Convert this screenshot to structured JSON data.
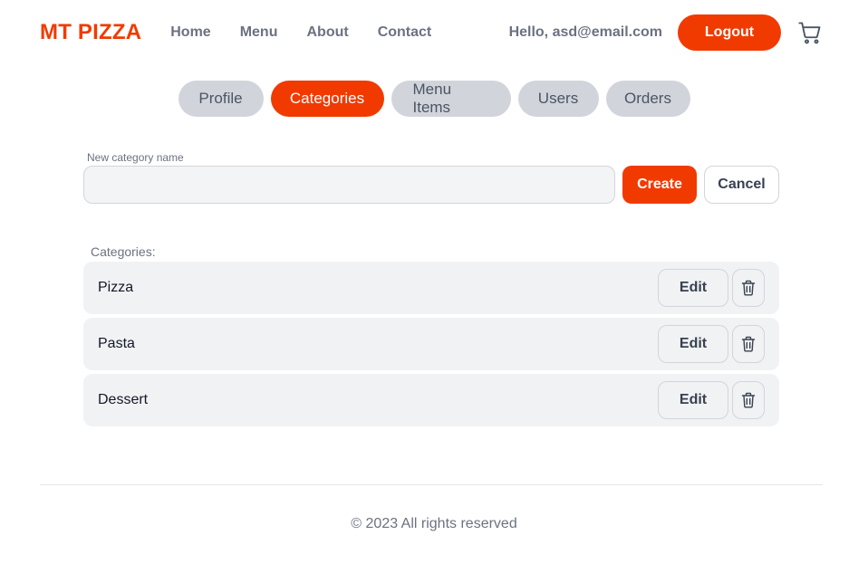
{
  "header": {
    "logo": "MT PIZZA",
    "nav": [
      "Home",
      "Menu",
      "About",
      "Contact"
    ],
    "greeting": "Hello, asd@email.com",
    "logout_label": "Logout",
    "cart_icon": "cart-icon"
  },
  "tabs": {
    "items": [
      "Profile",
      "Categories",
      "Menu Items",
      "Users",
      "Orders"
    ],
    "active": "Categories"
  },
  "form": {
    "label": "New category name",
    "value": "",
    "create_label": "Create",
    "cancel_label": "Cancel"
  },
  "categories": {
    "label": "Categories:",
    "items": [
      {
        "name": "Pizza",
        "edit_label": "Edit",
        "delete_icon": "trash-icon"
      },
      {
        "name": "Pasta",
        "edit_label": "Edit",
        "delete_icon": "trash-icon"
      },
      {
        "name": "Dessert",
        "edit_label": "Edit",
        "delete_icon": "trash-icon"
      }
    ]
  },
  "footer": {
    "text": "© 2023 All rights reserved"
  },
  "colors": {
    "accent": "#f13a00",
    "tab_inactive": "#d1d5db",
    "row_bg": "#f1f2f4"
  }
}
